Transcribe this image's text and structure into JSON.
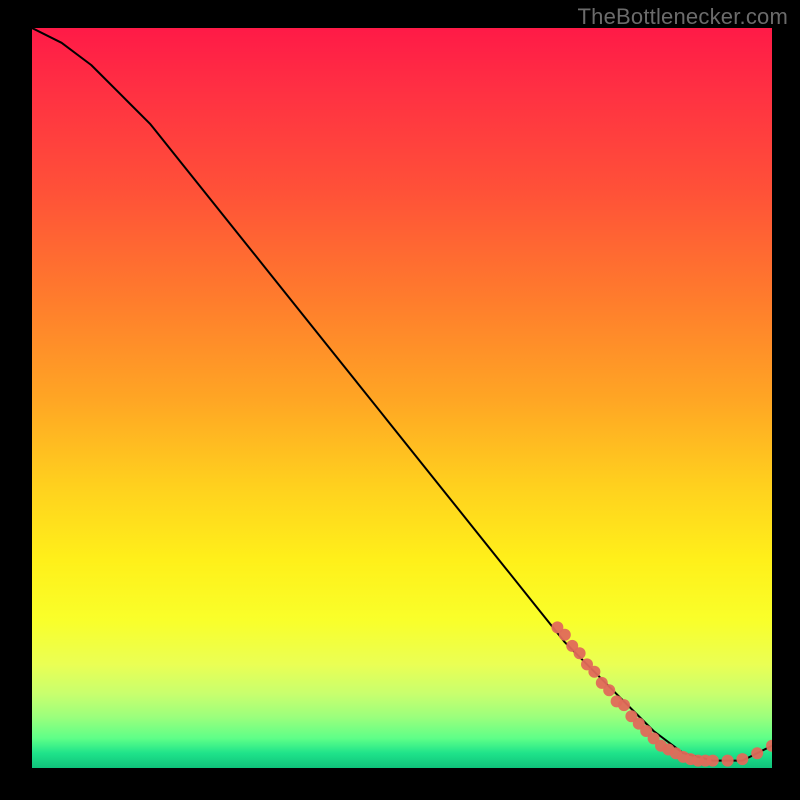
{
  "watermark": "TheBottlenecker.com",
  "chart_data": {
    "type": "line",
    "title": "",
    "xlabel": "",
    "ylabel": "",
    "xlim": [
      0,
      100
    ],
    "ylim": [
      0,
      100
    ],
    "grid": false,
    "legend": false,
    "series": [
      {
        "name": "bottleneck-curve",
        "color": "#000000",
        "x": [
          0,
          4,
          8,
          12,
          16,
          20,
          24,
          28,
          32,
          36,
          40,
          44,
          48,
          52,
          56,
          60,
          64,
          68,
          72,
          76,
          80,
          84,
          88,
          92,
          96,
          100
        ],
        "y": [
          100,
          98,
          95,
          91,
          87,
          82,
          77,
          72,
          67,
          62,
          57,
          52,
          47,
          42,
          37,
          32,
          27,
          22,
          17,
          13,
          9,
          5,
          2,
          1,
          1,
          3
        ]
      }
    ],
    "markers": [
      {
        "name": "curve-points",
        "color": "#e06a5a",
        "radius": 6,
        "points": [
          {
            "x": 71,
            "y": 19
          },
          {
            "x": 72,
            "y": 18
          },
          {
            "x": 73,
            "y": 16.5
          },
          {
            "x": 74,
            "y": 15.5
          },
          {
            "x": 75,
            "y": 14
          },
          {
            "x": 76,
            "y": 13
          },
          {
            "x": 77,
            "y": 11.5
          },
          {
            "x": 78,
            "y": 10.5
          },
          {
            "x": 79,
            "y": 9
          },
          {
            "x": 80,
            "y": 8.5
          },
          {
            "x": 81,
            "y": 7
          },
          {
            "x": 82,
            "y": 6
          },
          {
            "x": 83,
            "y": 5
          },
          {
            "x": 84,
            "y": 4
          },
          {
            "x": 85,
            "y": 3
          },
          {
            "x": 86,
            "y": 2.5
          },
          {
            "x": 87,
            "y": 2
          },
          {
            "x": 88,
            "y": 1.5
          },
          {
            "x": 89,
            "y": 1.2
          },
          {
            "x": 90,
            "y": 1
          },
          {
            "x": 91,
            "y": 1
          },
          {
            "x": 92,
            "y": 1
          },
          {
            "x": 94,
            "y": 1
          },
          {
            "x": 96,
            "y": 1.2
          },
          {
            "x": 98,
            "y": 2
          },
          {
            "x": 100,
            "y": 3
          }
        ]
      }
    ]
  }
}
